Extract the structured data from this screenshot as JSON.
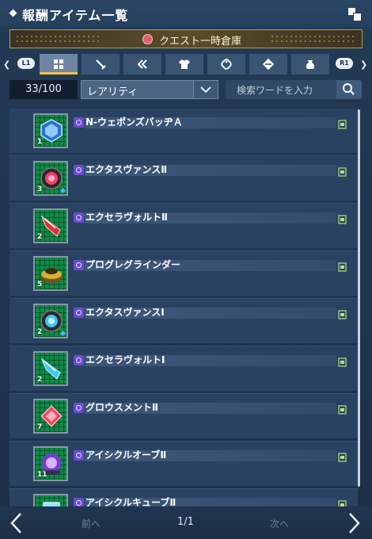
{
  "window": {
    "title": "報酬アイテム一覧",
    "icon": "window-restore-icon"
  },
  "storage": {
    "label": "クエスト一時倉庫",
    "icon": "storage-bag-icon"
  },
  "tabs": {
    "left_shoulder": "L1",
    "right_shoulder": "R1",
    "items": [
      {
        "icon": "grid-all-icon",
        "active": true
      },
      {
        "icon": "sword-icon",
        "active": false
      },
      {
        "icon": "double-arrow-icon",
        "active": false
      },
      {
        "icon": "shirt-icon",
        "active": false
      },
      {
        "icon": "tag-icon",
        "active": false
      },
      {
        "icon": "capsule-icon",
        "active": false
      },
      {
        "icon": "pouch-icon",
        "active": false
      }
    ]
  },
  "filters": {
    "count": "33/100",
    "rarity": "レアリティ",
    "search_placeholder": "検索ワードを入力"
  },
  "items": [
    {
      "name": "N-ウェポンズバッヂＡ",
      "count": "1",
      "icon": "badge-icon",
      "color": "#5ab4ff"
    },
    {
      "name": "エクタスヴァンスⅡ",
      "count": "3",
      "icon": "core-icon",
      "color": "#ff3d6a"
    },
    {
      "name": "エクセラヴォルトⅡ",
      "count": "2",
      "icon": "crystal-shard-icon",
      "color": "#e0303c"
    },
    {
      "name": "プログレグラインダー",
      "count": "5",
      "icon": "grinder-icon",
      "color": "#d9b030"
    },
    {
      "name": "エクタスヴァンスⅠ",
      "count": "2",
      "icon": "core-icon",
      "color": "#3ec3ff"
    },
    {
      "name": "エクセラヴォルトⅠ",
      "count": "2",
      "icon": "crystal-shard-icon",
      "color": "#40c8ff"
    },
    {
      "name": "グロウスメントⅡ",
      "count": "7",
      "icon": "growth-gem-icon",
      "color": "#ff4060"
    },
    {
      "name": "アイシクルオーブⅡ",
      "count": "11",
      "icon": "orb-icon",
      "color": "#b56bff"
    },
    {
      "name": "アイシクルキューブⅡ",
      "count": "",
      "icon": "cube-icon",
      "color": "#8fe4ff"
    }
  ],
  "pagination": {
    "prev": "前へ",
    "page": "1/1",
    "next": "次へ"
  }
}
